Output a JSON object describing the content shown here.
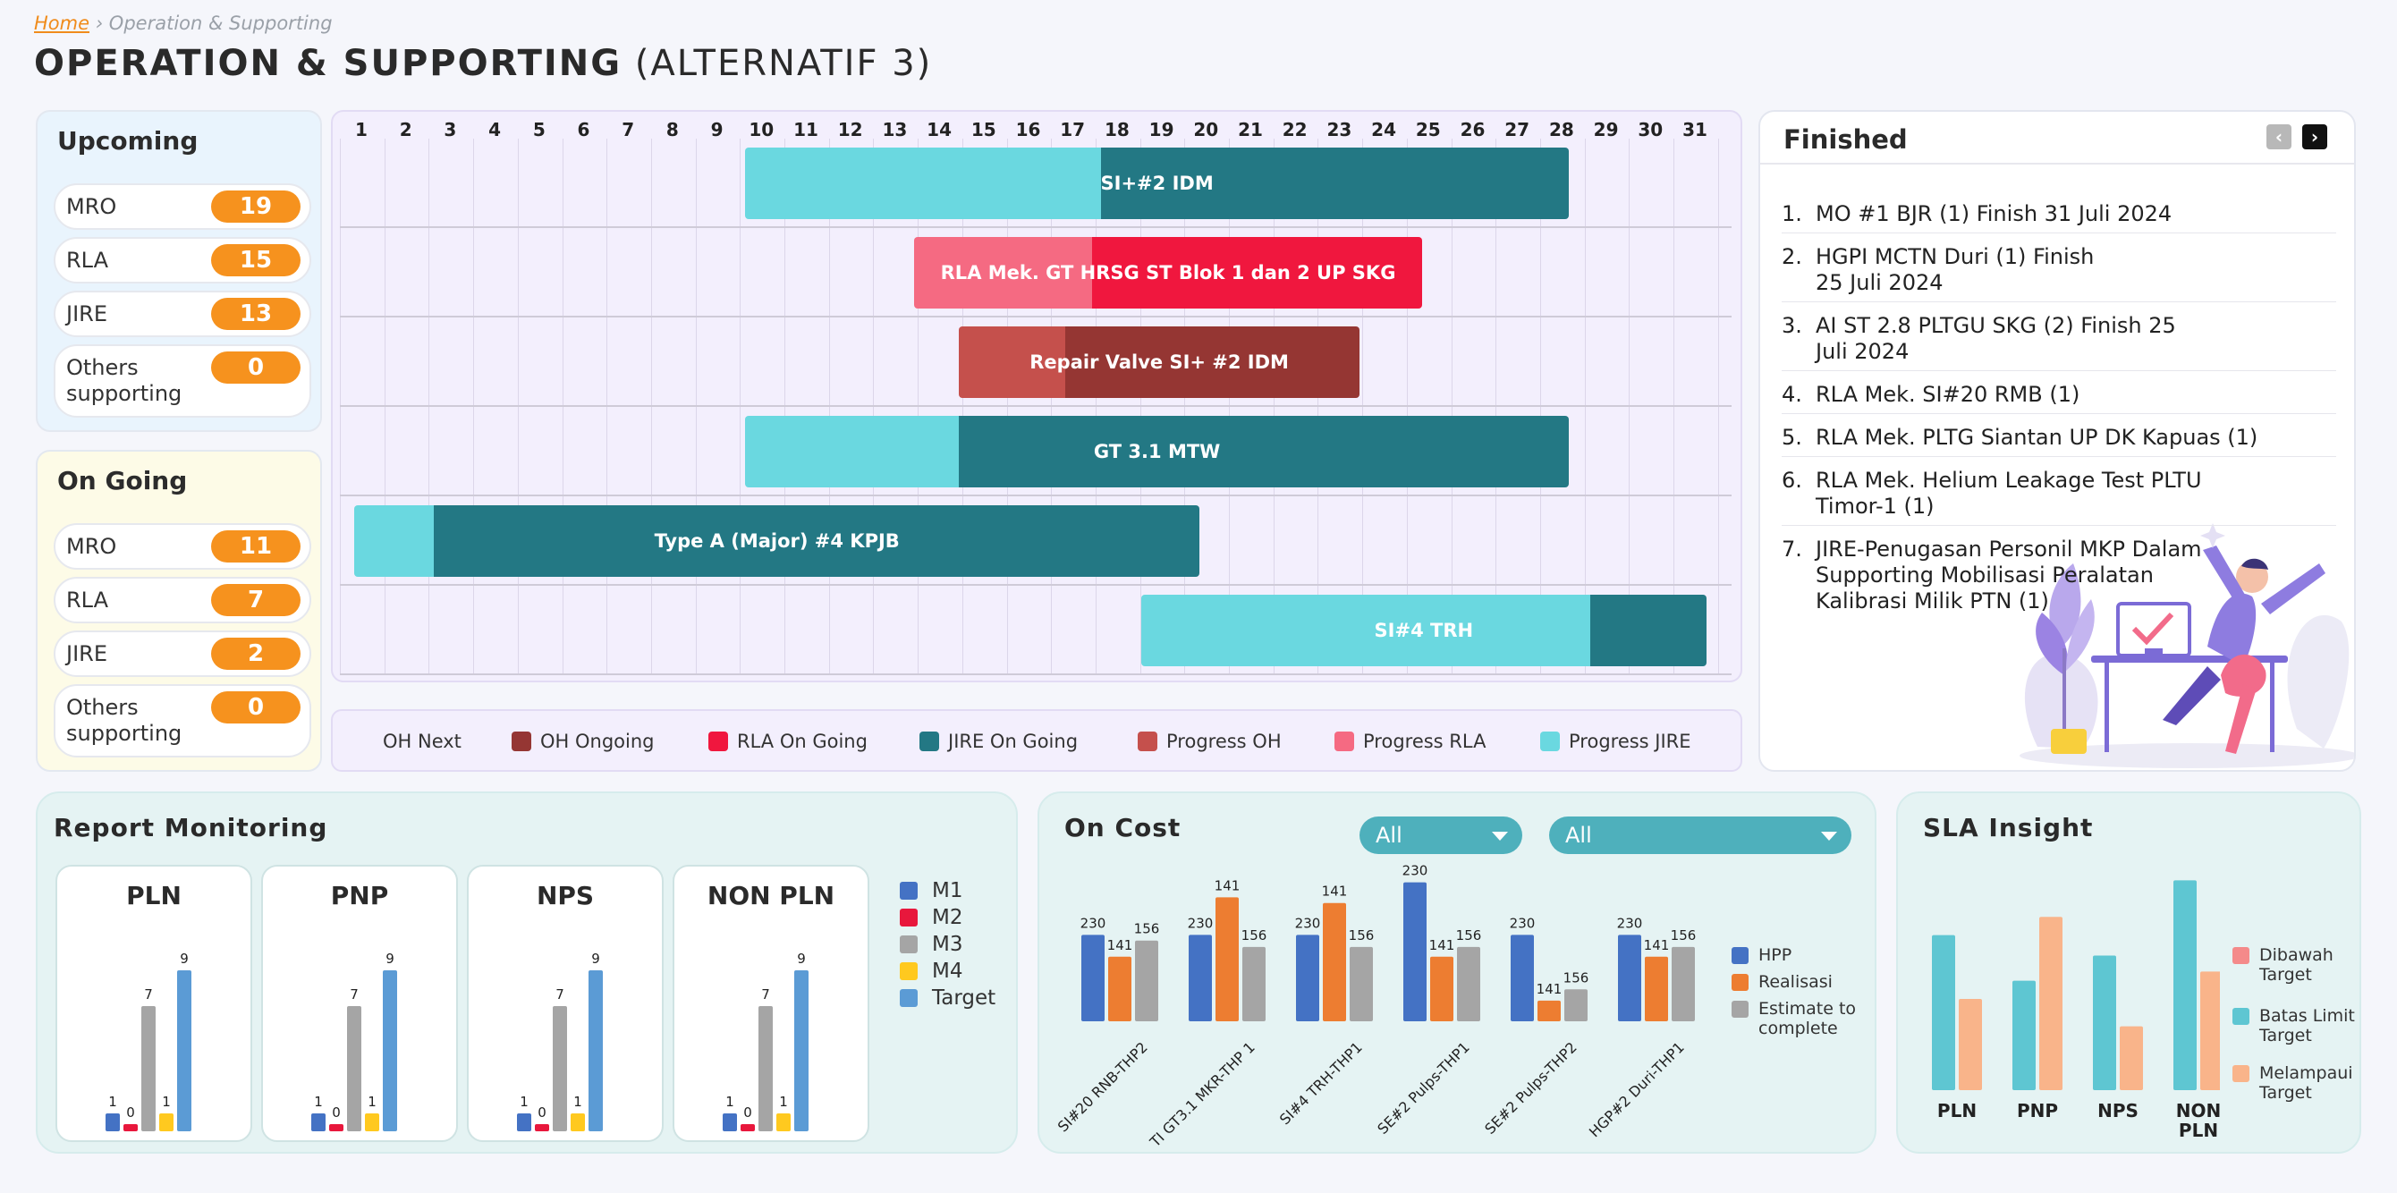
{
  "breadcrumb": {
    "home": "Home",
    "separator": "›",
    "current": "Operation & Supporting"
  },
  "title": {
    "main": "OPERATION & SUPPORTING",
    "sub": "(ALTERNATIF 3)"
  },
  "upcoming": {
    "title": "Upcoming",
    "items": [
      {
        "label": "MRO",
        "count": "19"
      },
      {
        "label": "RLA",
        "count": "15"
      },
      {
        "label": "JIRE",
        "count": "13"
      },
      {
        "label": "Others supporting",
        "count": "0"
      }
    ]
  },
  "ongoing": {
    "title": "On Going",
    "items": [
      {
        "label": "MRO",
        "count": "11"
      },
      {
        "label": "RLA",
        "count": "7"
      },
      {
        "label": "JIRE",
        "count": "2"
      },
      {
        "label": "Others supporting",
        "count": "0"
      }
    ]
  },
  "gantt": {
    "days": [
      "1",
      "2",
      "3",
      "4",
      "5",
      "6",
      "7",
      "8",
      "9",
      "10",
      "11",
      "12",
      "13",
      "14",
      "15",
      "16",
      "17",
      "18",
      "19",
      "20",
      "21",
      "22",
      "23",
      "24",
      "25",
      "26",
      "27",
      "28",
      "29",
      "30",
      "31"
    ],
    "bars": [
      {
        "label": "SI+#2 IDM",
        "start": 10,
        "end": 27.8,
        "split": 18,
        "progress_color": "#6ad8e0",
        "main_color": "#237884"
      },
      {
        "label": "RLA Mek. GT HRSG ST Blok 1 dan 2 UP SKG",
        "start": 13.8,
        "end": 24.5,
        "split": 17.8,
        "progress_color": "#f56a82",
        "main_color": "#f0173e"
      },
      {
        "label": "Repair Valve SI+ #2 IDM",
        "start": 14.8,
        "end": 23.1,
        "split": 17.2,
        "progress_color": "#c5504c",
        "main_color": "#953633"
      },
      {
        "label": "GT 3.1 MTW",
        "start": 10,
        "end": 27.8,
        "split": 14.8,
        "progress_color": "#6ad8e0",
        "main_color": "#237884"
      },
      {
        "label": "Type A (Major) #4 KPJB",
        "start": 1.2,
        "end": 19.5,
        "split": 3,
        "progress_color": "#6ad8e0",
        "main_color": "#237884"
      },
      {
        "label": "SI#4 TRH",
        "start": 18.9,
        "end": 30.9,
        "split": 29,
        "progress_color": "#6ad8e0",
        "main_color": "#237884",
        "progress_first": true
      }
    ]
  },
  "legend": [
    {
      "label": "OH Next",
      "color": ""
    },
    {
      "label": "OH Ongoing",
      "color": "#953633"
    },
    {
      "label": "RLA On Going",
      "color": "#f0173e"
    },
    {
      "label": "JIRE On Going",
      "color": "#237884"
    },
    {
      "label": "Progress OH",
      "color": "#c5504c"
    },
    {
      "label": "Progress RLA",
      "color": "#f56a82"
    },
    {
      "label": "Progress JIRE",
      "color": "#6ad8e0"
    }
  ],
  "finished": {
    "title": "Finished",
    "prev": "‹",
    "next": "›",
    "items": [
      {
        "num": "1.",
        "text": "MO #1 BJR (1) Finish 31 Juli 2024"
      },
      {
        "num": "2.",
        "text": "HGPI MCTN Duri (1) Finish 25 Juli 2024"
      },
      {
        "num": "3.",
        "text": "AI ST 2.8 PLTGU SKG (2) Finish 25 Juli 2024"
      },
      {
        "num": "4.",
        "text": "RLA Mek. SI#20 RMB (1)"
      },
      {
        "num": "5.",
        "text": "RLA Mek. PLTG Siantan UP DK Kapuas (1)"
      },
      {
        "num": "6.",
        "text": "RLA Mek. Helium Leakage Test PLTU Timor-1 (1)"
      },
      {
        "num": "7.",
        "text": "JIRE-Penugasan Personil MKP Dalam Supporting Mobilisasi Peralatan Kalibrasi Milik PTN (1)"
      }
    ]
  },
  "report_monitoring": {
    "title": "Report Monitoring",
    "legend": [
      {
        "label": "M1",
        "color": "#4472c4"
      },
      {
        "label": "M2",
        "color": "#e8173c"
      },
      {
        "label": "M3",
        "color": "#a5a5a5"
      },
      {
        "label": "M4",
        "color": "#ffc91f"
      },
      {
        "label": "Target",
        "color": "#5b9bd5"
      }
    ]
  },
  "on_cost": {
    "title": "On Cost",
    "filter1": "All",
    "filter2": "All",
    "legend": [
      {
        "label": "HPP",
        "color": "#4472c4"
      },
      {
        "label": "Realisasi",
        "color": "#ed7d31"
      },
      {
        "label": "Estimate to complete",
        "color": "#a5a5a5"
      }
    ]
  },
  "sla": {
    "title": "SLA Insight",
    "legend": [
      {
        "label": "Dibawah Target",
        "color": "#f48a8a"
      },
      {
        "label": "Batas Limit Target",
        "color": "#5ec6d2"
      },
      {
        "label": "Melampaui Target",
        "color": "#f9b48a"
      }
    ]
  },
  "chart_data": [
    {
      "type": "bar",
      "title": "PLN",
      "categories": [
        "M1",
        "M2",
        "M3",
        "M4",
        "Target"
      ],
      "values": [
        1,
        0,
        7,
        1,
        9
      ]
    },
    {
      "type": "bar",
      "title": "PNP",
      "categories": [
        "M1",
        "M2",
        "M3",
        "M4",
        "Target"
      ],
      "values": [
        1,
        0,
        7,
        1,
        9
      ]
    },
    {
      "type": "bar",
      "title": "NPS",
      "categories": [
        "M1",
        "M2",
        "M3",
        "M4",
        "Target"
      ],
      "values": [
        1,
        0,
        7,
        1,
        9
      ]
    },
    {
      "type": "bar",
      "title": "NON PLN",
      "categories": [
        "M1",
        "M2",
        "M3",
        "M4",
        "Target"
      ],
      "values": [
        1,
        0,
        7,
        1,
        9
      ]
    },
    {
      "type": "bar",
      "title": "On Cost",
      "categories": [
        "SI#20 RNB-THP2",
        "TI GT3.1 MKR-THP 1",
        "SI#4 TRH-THP1",
        "SE#2 Pulps-THP1",
        "SE#2 Pulps-THP2",
        "HGP#2 Duri-THP1"
      ],
      "series": [
        {
          "name": "HPP",
          "values": [
            230,
            230,
            230,
            230,
            230,
            230
          ]
        },
        {
          "name": "Realisasi",
          "values": [
            141,
            141,
            141,
            141,
            141,
            141
          ]
        },
        {
          "name": "Estimate to complete",
          "values": [
            156,
            156,
            156,
            156,
            156,
            156
          ]
        }
      ],
      "display_heights": [
        [
          230,
          172,
          215
        ],
        [
          230,
          330,
          198
        ],
        [
          230,
          315,
          198
        ],
        [
          370,
          172,
          198
        ],
        [
          230,
          55,
          85
        ],
        [
          230,
          172,
          198
        ]
      ]
    },
    {
      "type": "bar",
      "title": "SLA Insight",
      "categories": [
        "PLN",
        "PNP",
        "NPS",
        "NON PLN"
      ],
      "series": [
        {
          "name": "Batas Limit Target",
          "values": [
            68,
            48,
            59,
            92
          ]
        },
        {
          "name": "Melampaui Target",
          "values": [
            40,
            76,
            28,
            52
          ]
        }
      ]
    }
  ]
}
